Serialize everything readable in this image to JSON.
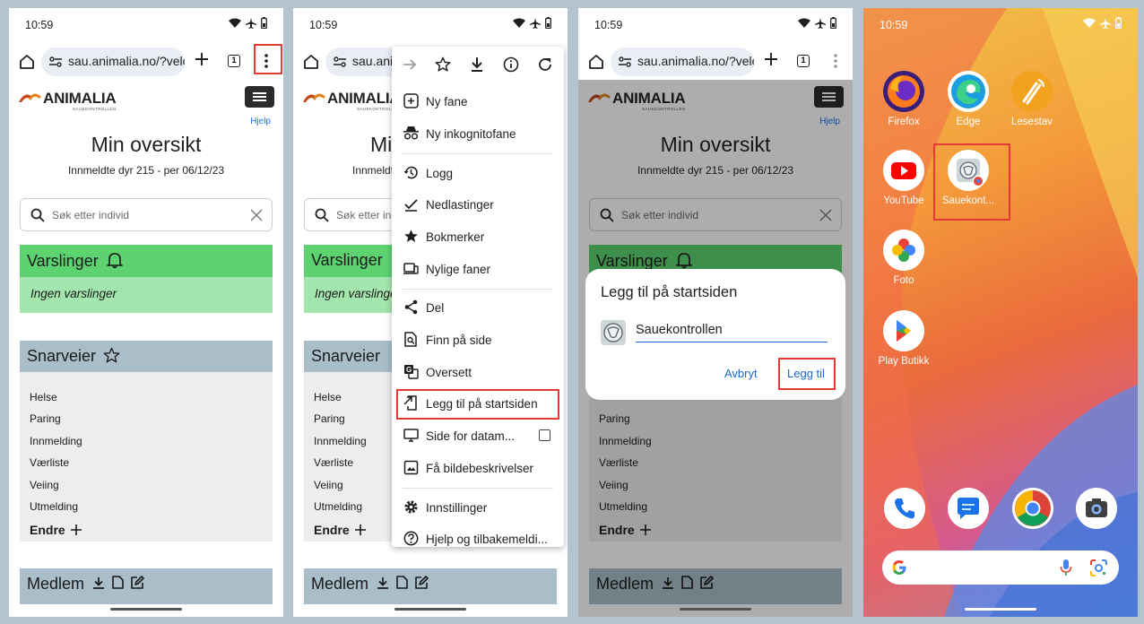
{
  "status_bar": {
    "time": "10:59"
  },
  "toolbar": {
    "url": "sau.animalia.no/?velg"
  },
  "page": {
    "brand": "ANIMALIA",
    "brand_sub": "SAUEKONTROLLEN",
    "help_link": "Hjelp",
    "title": "Min oversikt",
    "subtitle": "Innmeldte dyr 215 - per 06/12/23",
    "search_placeholder": "Søk etter individ",
    "alerts_title": "Varslinger",
    "alerts_empty": "Ingen varslinger",
    "shortcuts_title": "Snarveier",
    "shortcuts": [
      "Helse",
      "Paring",
      "Innmelding",
      "Værliste",
      "Veiing",
      "Utmelding"
    ],
    "edit_label": "Endre",
    "member_title": "Medlem"
  },
  "menu": {
    "items": [
      {
        "label": "Ny fane",
        "icon": "new-tab-icon"
      },
      {
        "label": "Ny inkognitofane",
        "icon": "incognito-icon"
      },
      {
        "label": "Logg",
        "icon": "history-icon"
      },
      {
        "label": "Nedlastinger",
        "icon": "downloads-icon"
      },
      {
        "label": "Bokmerker",
        "icon": "bookmarks-icon"
      },
      {
        "label": "Nylige faner",
        "icon": "recent-tabs-icon"
      },
      {
        "label": "Del",
        "icon": "share-icon"
      },
      {
        "label": "Finn på side",
        "icon": "find-icon"
      },
      {
        "label": "Oversett",
        "icon": "translate-icon"
      },
      {
        "label": "Legg til på startsiden",
        "icon": "add-to-home-icon"
      },
      {
        "label": "Side for datam...",
        "icon": "desktop-icon"
      },
      {
        "label": "Få bildebeskrivelser",
        "icon": "image-icon"
      },
      {
        "label": "Innstillinger",
        "icon": "settings-icon"
      },
      {
        "label": "Hjelp og tilbakemeldi...",
        "icon": "help-icon"
      }
    ]
  },
  "dialog": {
    "title": "Legg til på startsiden",
    "name_value": "Sauekontrollen",
    "cancel_label": "Avbryt",
    "confirm_label": "Legg til"
  },
  "home_screen": {
    "apps": [
      "Firefox",
      "Edge",
      "Lesestav",
      "YouTube",
      "Sauekont...",
      "Foto",
      "Play Butikk"
    ]
  },
  "colors": {
    "alert_green": "#5cd370",
    "section_grey_blue": "#a9bec8",
    "highlight_red": "#e53935",
    "link_blue": "#1967d2"
  }
}
